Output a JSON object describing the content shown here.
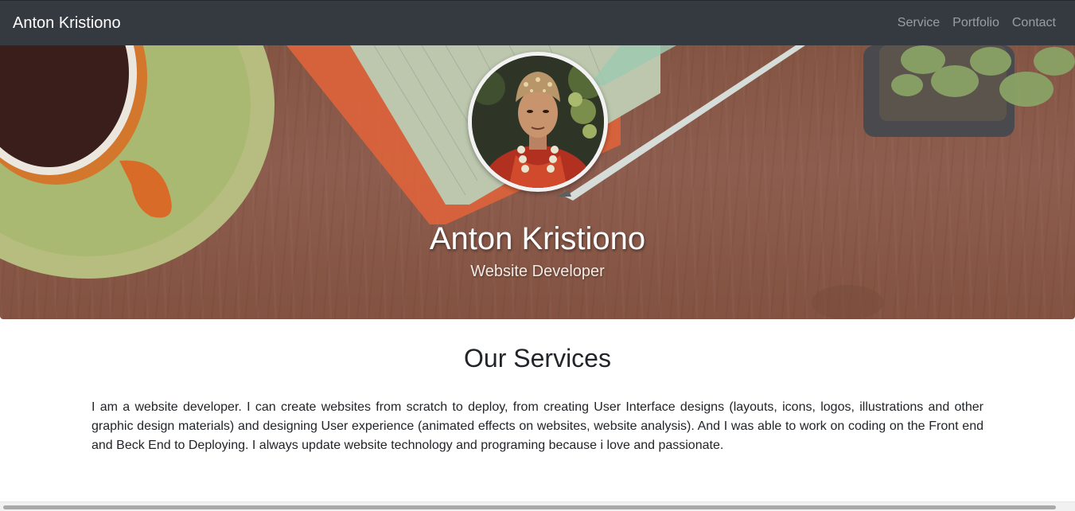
{
  "navbar": {
    "brand": "Anton Kristiono",
    "links": [
      "Service",
      "Portfolio",
      "Contact"
    ]
  },
  "hero": {
    "name": "Anton Kristiono",
    "role": "Website Developer",
    "avatar_alt": "profile-photo"
  },
  "services": {
    "title": "Our Services",
    "text": "I am a website developer. I can create websites from scratch to deploy, from creating User Interface designs (layouts, icons, logos, illustrations and other graphic design materials) and designing User experience (animated effects on websites, website analysis). And I was able to work on coding on the Front end and Beck End to Deploying. I always update website technology and programing because i love and passionate."
  },
  "colors": {
    "navbar_bg": "#343a40",
    "nav_link": "rgba(255,255,255,0.5)",
    "text": "#212529"
  }
}
